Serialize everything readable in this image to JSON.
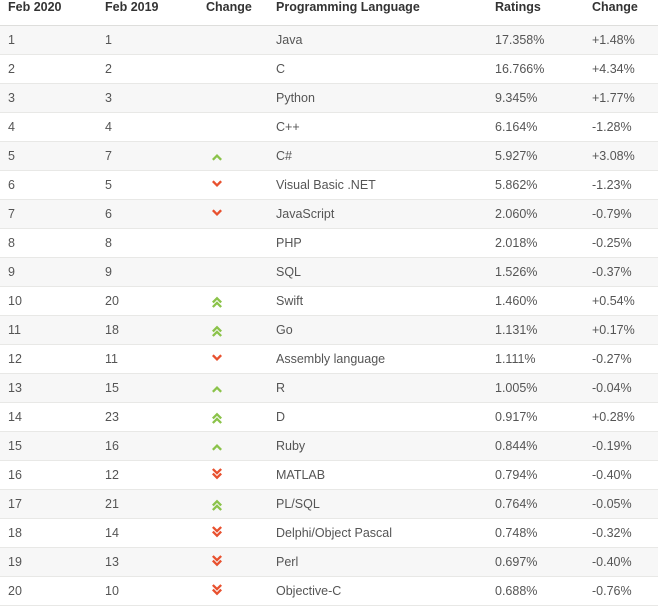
{
  "table": {
    "headers": {
      "rank_new": "Feb 2020",
      "rank_old": "Feb 2019",
      "change": "Change",
      "language": "Programming Language",
      "ratings": "Ratings",
      "delta": "Change"
    },
    "colors": {
      "up_arrow": "#8bc34a",
      "down_arrow": "#e8512f",
      "header_text": "#333333",
      "body_text": "#555555",
      "row_odd_bg": "#f7f7f7",
      "row_even_bg": "#ffffff",
      "row_border": "#e8e8e6",
      "header_border": "#dededc"
    },
    "rows": [
      {
        "rank_new": "1",
        "rank_old": "1",
        "change_icon": "none",
        "language": "Java",
        "ratings": "17.358%",
        "delta": "+1.48%"
      },
      {
        "rank_new": "2",
        "rank_old": "2",
        "change_icon": "none",
        "language": "C",
        "ratings": "16.766%",
        "delta": "+4.34%"
      },
      {
        "rank_new": "3",
        "rank_old": "3",
        "change_icon": "none",
        "language": "Python",
        "ratings": "9.345%",
        "delta": "+1.77%"
      },
      {
        "rank_new": "4",
        "rank_old": "4",
        "change_icon": "none",
        "language": "C++",
        "ratings": "6.164%",
        "delta": "-1.28%"
      },
      {
        "rank_new": "5",
        "rank_old": "7",
        "change_icon": "up-single",
        "language": "C#",
        "ratings": "5.927%",
        "delta": "+3.08%"
      },
      {
        "rank_new": "6",
        "rank_old": "5",
        "change_icon": "down-single",
        "language": "Visual Basic .NET",
        "ratings": "5.862%",
        "delta": "-1.23%"
      },
      {
        "rank_new": "7",
        "rank_old": "6",
        "change_icon": "down-single",
        "language": "JavaScript",
        "ratings": "2.060%",
        "delta": "-0.79%"
      },
      {
        "rank_new": "8",
        "rank_old": "8",
        "change_icon": "none",
        "language": "PHP",
        "ratings": "2.018%",
        "delta": "-0.25%"
      },
      {
        "rank_new": "9",
        "rank_old": "9",
        "change_icon": "none",
        "language": "SQL",
        "ratings": "1.526%",
        "delta": "-0.37%"
      },
      {
        "rank_new": "10",
        "rank_old": "20",
        "change_icon": "up-double",
        "language": "Swift",
        "ratings": "1.460%",
        "delta": "+0.54%"
      },
      {
        "rank_new": "11",
        "rank_old": "18",
        "change_icon": "up-double",
        "language": "Go",
        "ratings": "1.131%",
        "delta": "+0.17%"
      },
      {
        "rank_new": "12",
        "rank_old": "11",
        "change_icon": "down-single",
        "language": "Assembly language",
        "ratings": "1.111%",
        "delta": "-0.27%"
      },
      {
        "rank_new": "13",
        "rank_old": "15",
        "change_icon": "up-single",
        "language": "R",
        "ratings": "1.005%",
        "delta": "-0.04%"
      },
      {
        "rank_new": "14",
        "rank_old": "23",
        "change_icon": "up-double",
        "language": "D",
        "ratings": "0.917%",
        "delta": "+0.28%"
      },
      {
        "rank_new": "15",
        "rank_old": "16",
        "change_icon": "up-single",
        "language": "Ruby",
        "ratings": "0.844%",
        "delta": "-0.19%"
      },
      {
        "rank_new": "16",
        "rank_old": "12",
        "change_icon": "down-double",
        "language": "MATLAB",
        "ratings": "0.794%",
        "delta": "-0.40%"
      },
      {
        "rank_new": "17",
        "rank_old": "21",
        "change_icon": "up-double",
        "language": "PL/SQL",
        "ratings": "0.764%",
        "delta": "-0.05%"
      },
      {
        "rank_new": "18",
        "rank_old": "14",
        "change_icon": "down-double",
        "language": "Delphi/Object Pascal",
        "ratings": "0.748%",
        "delta": "-0.32%"
      },
      {
        "rank_new": "19",
        "rank_old": "13",
        "change_icon": "down-double",
        "language": "Perl",
        "ratings": "0.697%",
        "delta": "-0.40%"
      },
      {
        "rank_new": "20",
        "rank_old": "10",
        "change_icon": "down-double",
        "language": "Objective-C",
        "ratings": "0.688%",
        "delta": "-0.76%"
      }
    ]
  }
}
